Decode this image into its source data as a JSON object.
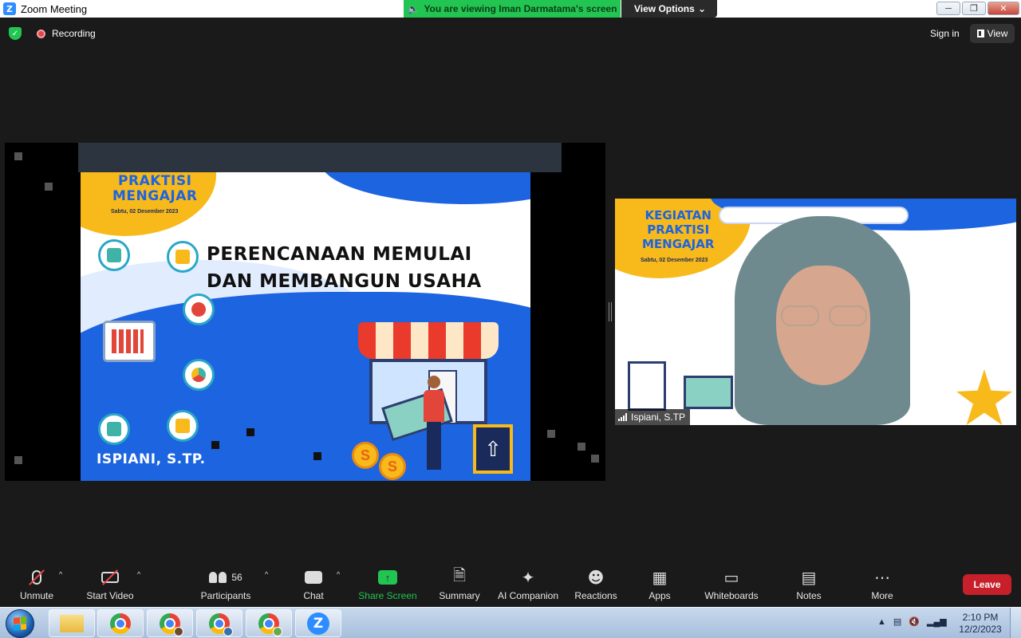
{
  "window": {
    "app_logo": "Z",
    "title": "Zoom Meeting",
    "viewing_banner": "You are viewing Iman Darmatama's screen",
    "view_options": "View Options",
    "controls": [
      "minimize-icon",
      "restore-icon",
      "close-icon"
    ]
  },
  "infobar": {
    "recording": "Recording",
    "sign_in": "Sign in",
    "view": "View"
  },
  "slide": {
    "header_line1": "PRAKTISI",
    "header_line2": "MENGAJAR",
    "date": "Sabtu, 02 Desember 2023",
    "title_line1": "PERENCANAAN MEMULAI",
    "title_line2": "DAN MEMBANGUN USAHA",
    "speaker": "ISPIANI, S.TP.",
    "coin_label": "S"
  },
  "video": {
    "header_line1": "KEGIATAN",
    "header_line2": "PRAKTISI",
    "header_line3": "MENGAJAR",
    "date": "Sabtu, 02 Desember 2023",
    "participant_name": "Ispiani, S.TP"
  },
  "toolbar": {
    "unmute": "Unmute",
    "start_video": "Start Video",
    "participants": "Participants",
    "participants_count": "56",
    "chat": "Chat",
    "share_screen": "Share Screen",
    "summary": "Summary",
    "ai_companion": "AI Companion",
    "reactions": "Reactions",
    "apps": "Apps",
    "whiteboards": "Whiteboards",
    "notes": "Notes",
    "more": "More",
    "leave": "Leave",
    "accent_green": "#23c552",
    "leave_red": "#c8202a"
  },
  "taskbar": {
    "apps": [
      "start-button",
      "file-explorer",
      "chrome",
      "chrome",
      "chrome",
      "chrome",
      "zoom"
    ],
    "time": "2:10 PM",
    "date": "12/2/2023"
  }
}
